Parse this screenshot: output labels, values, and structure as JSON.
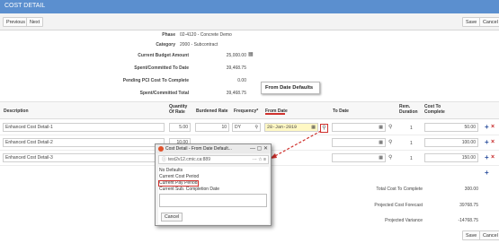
{
  "title": "COST DETAIL",
  "toolbar": {
    "previous": "Previous",
    "next": "Next",
    "save": "Save",
    "cancel": "Cancel"
  },
  "summary": {
    "phase_label": "Phase",
    "phase_value": "02-4120 - Concrete Demo",
    "category_label": "Category",
    "category_value": "2000 - Subcontract",
    "budget_label": "Current Budget Amount",
    "budget_value": "25,000.00",
    "spent_label": "Spent/Committed To Date",
    "spent_value": "39,468.75",
    "pci_label": "Pending PCI Cost To Complete",
    "pci_value": "0.00",
    "total_label": "Spent/Committed Total",
    "total_value": "39,468.75"
  },
  "callout": "From Date Defaults",
  "table": {
    "headers": {
      "description": "Description",
      "qty": "Quantity Of Rate",
      "rate": "Burdened Rate",
      "frequency": "Frequency*",
      "from": "From Date",
      "to": "To Date",
      "rem": "Rem. Duration",
      "cost": "Cost To Complete"
    },
    "rows": [
      {
        "description": "Enhanced Cost Detail-1",
        "qty": "5.00",
        "rate": "10",
        "frequency": "DY",
        "from": "28-Jan-2019",
        "rem": "1",
        "cost": "50.00"
      },
      {
        "description": "Enhanced Cost Detail-2",
        "qty": "10.00",
        "rem": "1",
        "cost": "100.00"
      },
      {
        "description": "Enhanced Cost Detail-3",
        "rem": "1",
        "cost": "150.00"
      }
    ]
  },
  "totals": {
    "ctc_label": "Total Cost To Complete",
    "ctc_value": "300.00",
    "forecast_label": "Projected Cost Forecast",
    "forecast_value": "39768.75",
    "variance_label": "Projected Variance",
    "variance_value": "-14768.75"
  },
  "popup": {
    "title": "Cost Detail - From Date Default...",
    "address": "test2v12.cmic.ca:889",
    "options": [
      "No Defaults",
      "Current Cost Period",
      "Current Pay Period",
      "Current Sub. Completion Date"
    ],
    "cancel": "Cancel"
  },
  "colors": {
    "header_blue": "#5b8fcf",
    "highlight_red": "#d0312d",
    "from_date_yellow": "#fff8c4"
  }
}
